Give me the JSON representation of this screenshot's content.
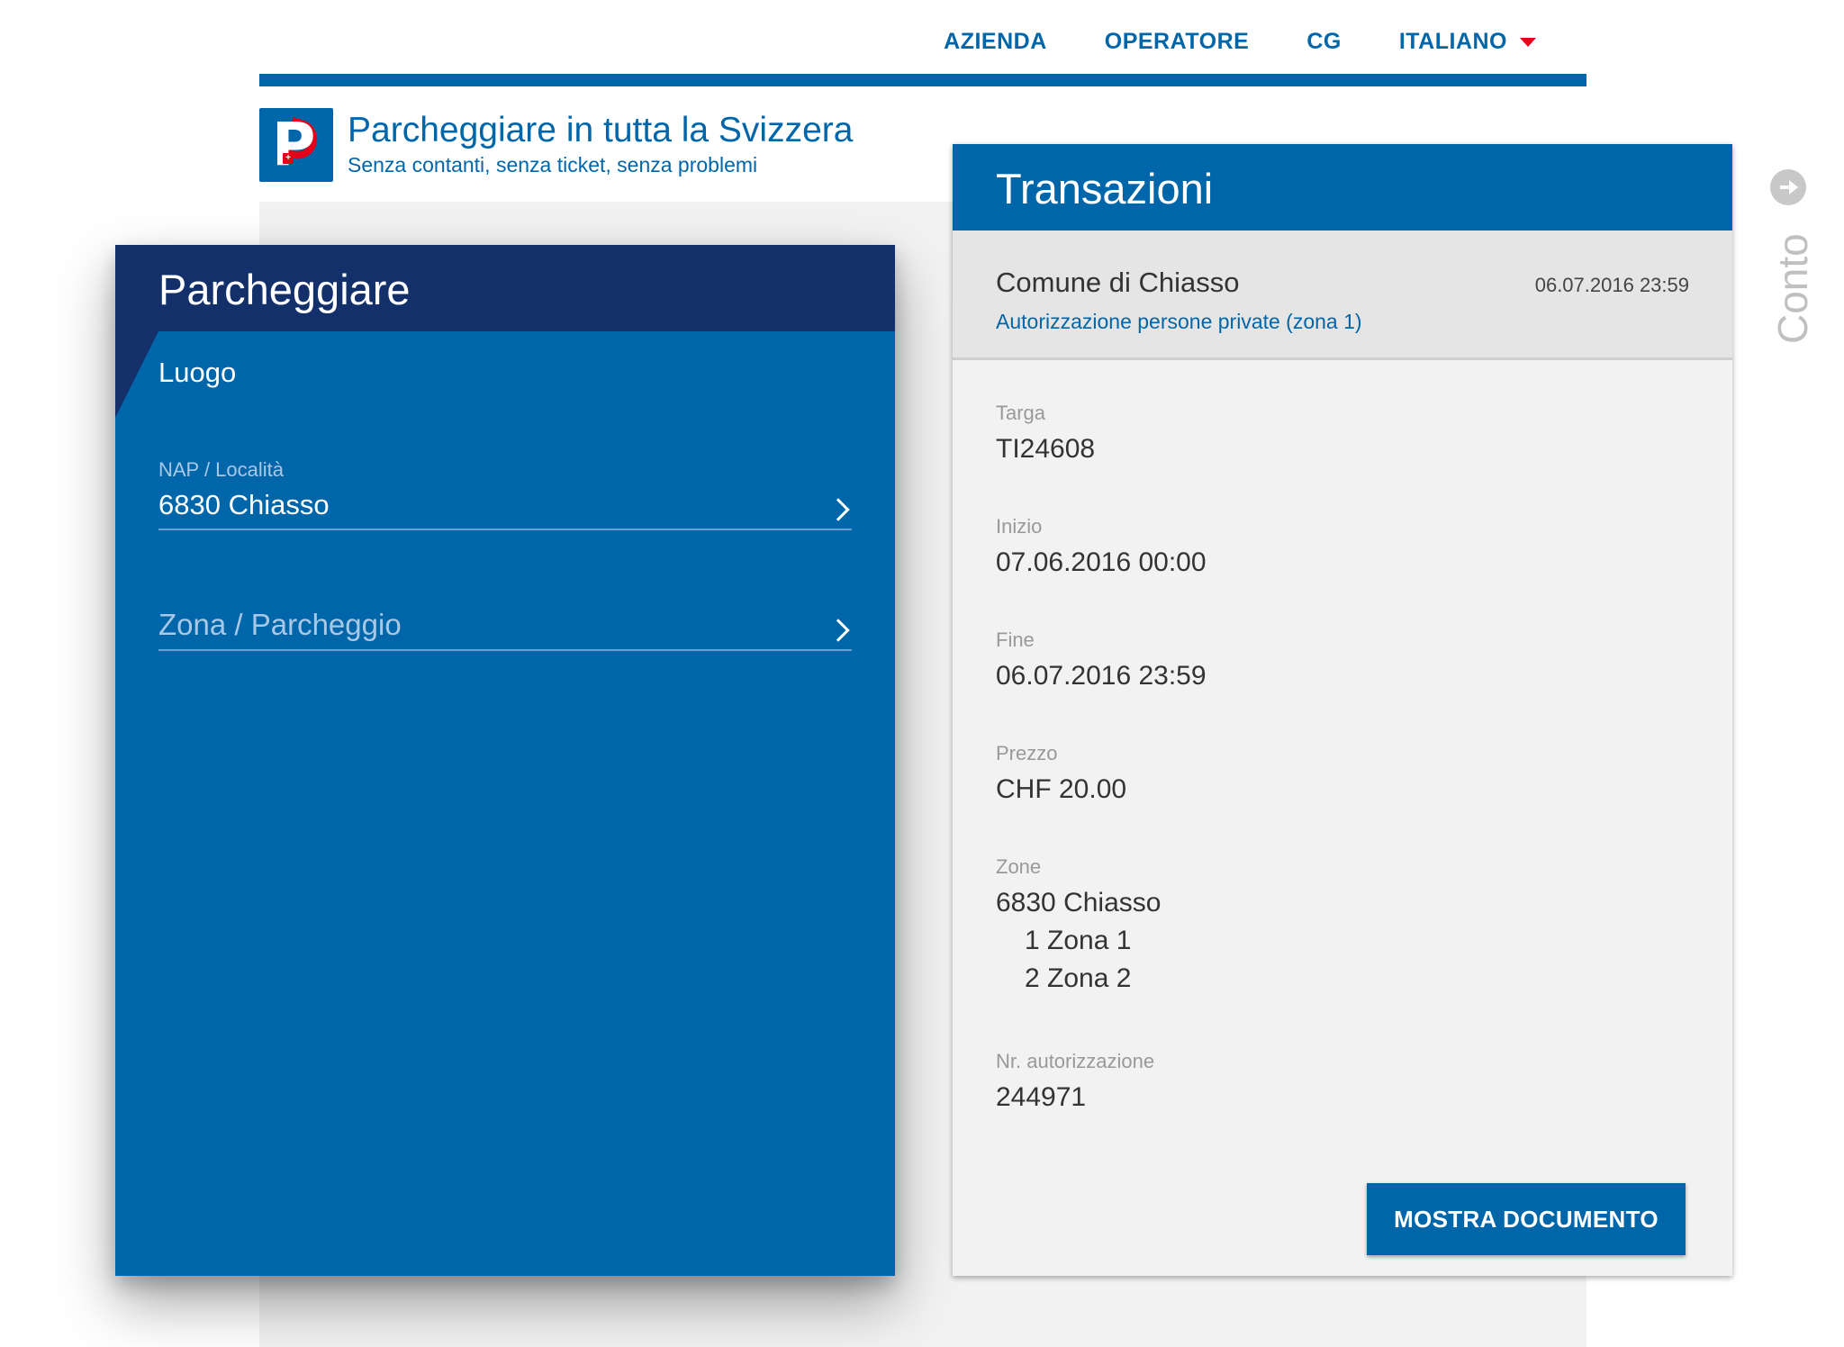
{
  "nav": {
    "items": [
      "AZIENDA",
      "OPERATORE",
      "CG"
    ],
    "language": "ITALIANO"
  },
  "brand": {
    "title": "Parcheggiare in tutta la Svizzera",
    "subtitle": "Senza contanti, senza ticket, senza problemi"
  },
  "parking": {
    "title": "Parcheggiare",
    "section": "Luogo",
    "location_label": "NAP / Località",
    "location_value": "6830 Chiasso",
    "zone_placeholder": "Zona / Parcheggio"
  },
  "transactions": {
    "title": "Transazioni",
    "summary": {
      "name": "Comune di Chiasso",
      "date": "06.07.2016 23:59",
      "product": "Autorizzazione persone private (zona 1)"
    },
    "details": {
      "plate_label": "Targa",
      "plate_value": "TI24608",
      "start_label": "Inizio",
      "start_value": "07.06.2016 00:00",
      "end_label": "Fine",
      "end_value": "06.07.2016 23:59",
      "price_label": "Prezzo",
      "price_value": "CHF 20.00",
      "zones_label": "Zone",
      "zones_value": "6830 Chiasso",
      "zones_list": [
        "1 Zona 1",
        "2 Zona 2"
      ],
      "auth_label": "Nr. autorizzazione",
      "auth_value": "244971"
    },
    "button": "MOSTRA DOCUMENTO"
  },
  "rail": {
    "label": "Conto",
    "icon": "arrow-right-circle-icon"
  },
  "colors": {
    "primary": "#0066aa",
    "dark": "#13306b",
    "accent": "#e2001a"
  }
}
